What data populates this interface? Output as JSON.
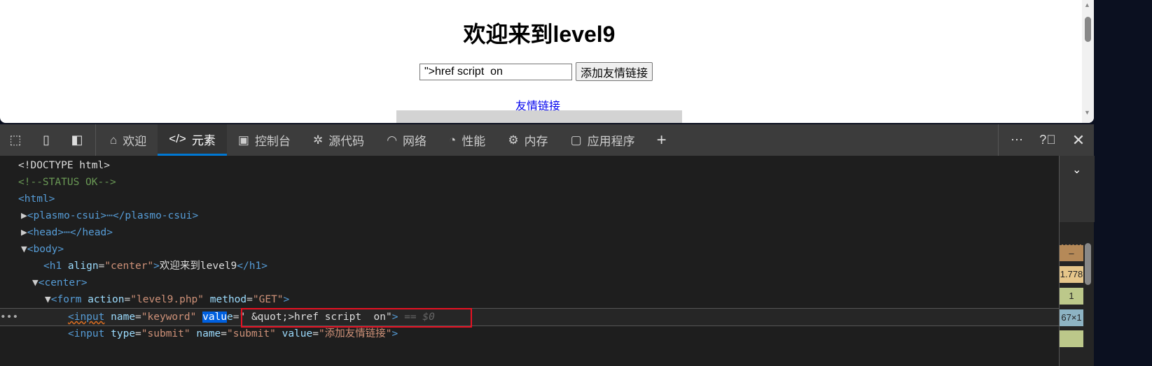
{
  "page": {
    "title": "欢迎来到level9",
    "keyword_value": "\">href script  on",
    "submit_label": "添加友情链接",
    "link_text": "友情链接"
  },
  "toolbar": {
    "tabs": [
      {
        "label": "欢迎",
        "icon": "home-icon"
      },
      {
        "label": "元素",
        "icon": "code-icon"
      },
      {
        "label": "控制台",
        "icon": "console-icon"
      },
      {
        "label": "源代码",
        "icon": "bug-icon"
      },
      {
        "label": "网络",
        "icon": "wifi-icon"
      },
      {
        "label": "性能",
        "icon": "gauge-icon"
      },
      {
        "label": "内存",
        "icon": "chip-icon"
      },
      {
        "label": "应用程序",
        "icon": "app-icon"
      }
    ],
    "active_tab": "元素"
  },
  "dom": {
    "l1": "<!DOCTYPE html>",
    "l2": "<!--STATUS OK-->",
    "l3": "<html>",
    "l4a": "<plasmo-csui>",
    "l4b": "</plasmo-csui>",
    "l5a": "<head>",
    "l5b": "</head>",
    "l6": "<body>",
    "h1_open": "<h1 ",
    "h1_attr": "align",
    "h1_val": "\"center\"",
    "h1_text": "欢迎来到level9",
    "h1_close": "</h1>",
    "center": "<center>",
    "form_open": "<form ",
    "form_a1": "action",
    "form_v1": "\"level9.php\"",
    "form_a2": "method",
    "form_v2": "\"GET\"",
    "input_tag": "<input",
    "input_name_attr": "name",
    "input_name_val": "\"keyword\"",
    "value_attr_hl": "valu",
    "value_attr_rest": "e",
    "input_value": "\" &quot;>href script  on\"",
    "selected_marker": "== $0",
    "sub_type_attr": "type",
    "sub_type_val": "\"submit\"",
    "sub_name_val": "\"submit\"",
    "sub_value_val": "\"添加友情链接\""
  },
  "side": {
    "values": [
      "–",
      "1.778",
      "1",
      "67×1"
    ]
  }
}
